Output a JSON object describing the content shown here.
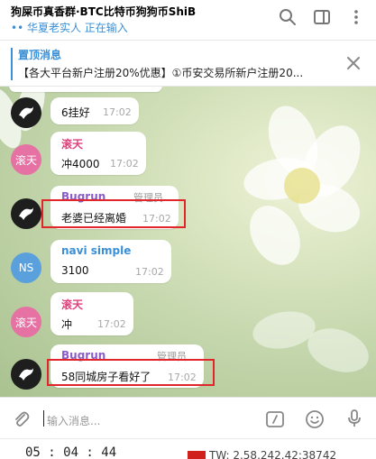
{
  "header": {
    "title": "狗屎币真香群·BTC比特币狗狗币ShiB",
    "status": "•• 华夏老实人 正在输入"
  },
  "pinned": {
    "label": "置顶消息",
    "text": "【各大平台新户注册20%优惠】①币安交易所新户注册20..."
  },
  "messages": [
    {
      "text": "6挂好",
      "time": "17:02"
    },
    {
      "avatar": "滚天",
      "name": "滚天",
      "text": "冲4000",
      "time": "17:02"
    },
    {
      "name": "Bugrun",
      "role": "管理员",
      "text": "老婆已经离婚",
      "time": "17:02"
    },
    {
      "avatar": "NS",
      "name": "navi simple",
      "text": "3100",
      "time": "17:02"
    },
    {
      "avatar": "滚天",
      "name": "滚天",
      "text": "冲",
      "time": "17:02"
    },
    {
      "name": "Bugrun",
      "role": "管理员",
      "text": "58同城房子看好了",
      "time": "17:02"
    }
  ],
  "input": {
    "placeholder": "输入消息..."
  },
  "bottom": {
    "clock": "05 : 04 : 44",
    "network": "TW: 2.58.242.42:38742"
  },
  "colors": {
    "accent": "#3a8fd6",
    "name_pink": "#e0407a",
    "name_purple": "#8a5cc8",
    "name_blue": "#3a8fd6",
    "highlight": "#e2252b"
  }
}
